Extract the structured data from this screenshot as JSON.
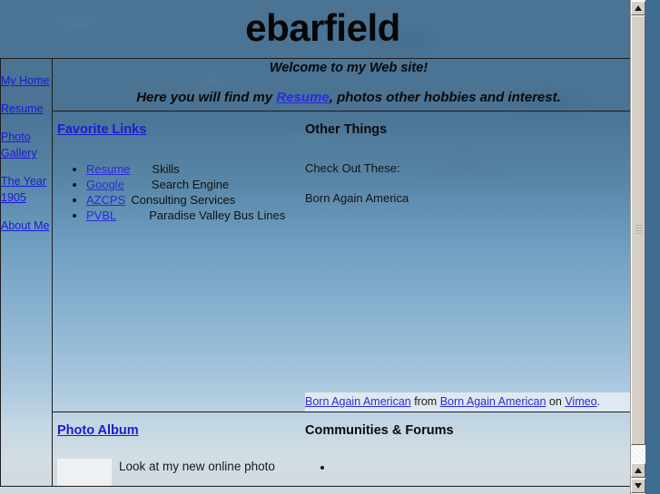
{
  "site": {
    "title": "ebarfield"
  },
  "sidebar": {
    "items": [
      {
        "label": "My Home",
        "name": "my-home"
      },
      {
        "label": "Resume",
        "name": "resume"
      },
      {
        "label": "Photo Gallery",
        "name": "photo-gallery"
      },
      {
        "label": "The Year 1905",
        "name": "the-year-1905"
      },
      {
        "label": "About Me",
        "name": "about-me"
      }
    ]
  },
  "welcome": {
    "line1": "Welcome to my Web site!",
    "line2_before": "Here you will find my ",
    "line2_link": "Resume",
    "line2_after": ", photos other hobbies and interest."
  },
  "favorite_links": {
    "heading": "Favorite Links",
    "items": [
      {
        "link": "Resume",
        "desc": "Skills"
      },
      {
        "link": "Google",
        "desc": "Search Engine"
      },
      {
        "link": "AZCPS",
        "desc": "Consulting Services"
      },
      {
        "link": "PVBL",
        "desc": "Paradise Valley Bus Lines"
      }
    ]
  },
  "other_things": {
    "heading": "Other Things",
    "line1": "Check Out These:",
    "line2": "Born Again America",
    "video_credit": {
      "link1": "Born Again American",
      "mid1": " from ",
      "link2": "Born Again American",
      "mid2": " on ",
      "link3": "Vimeo",
      "tail": "."
    }
  },
  "photo_album": {
    "heading": "Photo Album",
    "blurb": "Look at my new online photo"
  },
  "communities": {
    "heading": "Communities & Forums",
    "items": [
      ""
    ]
  },
  "scrollbar": {
    "up_icon": "triangle-up-icon",
    "down_icon": "triangle-down-icon"
  },
  "colors": {
    "link": "#1b1bd6",
    "text": "#0b0b0b",
    "sky_top": "#4a7394",
    "sky_bottom": "#cfd8df"
  }
}
